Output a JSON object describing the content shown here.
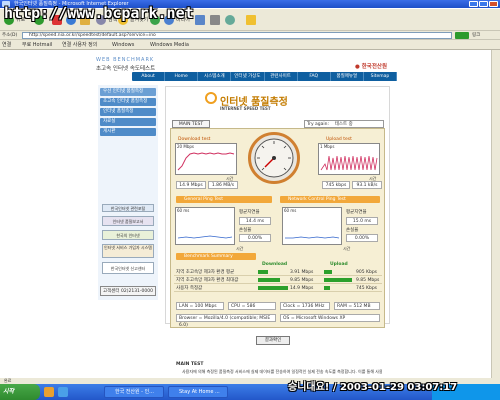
{
  "window": {
    "title": "한국인터넷 품질측정 - Microsoft Internet Explorer"
  },
  "watermark": "http://www.bcpark.net",
  "toolbar": {
    "back": "뒤로",
    "search": "검색",
    "favorites": "즐겨찾기",
    "media": "미디어"
  },
  "address": {
    "label": "주소(D)",
    "url": "http://speed.nia.or.kr/speedtest/default.asp?service=ino",
    "links_label": "링크"
  },
  "links": [
    "연결",
    "무료 Hotmail",
    "연결 사용자 정의",
    "Windows",
    "Windows Media"
  ],
  "site": {
    "logo_top": "WEB BENCHMARK",
    "logo_bottom": "초고속 인터넷 속도테스트",
    "corp": "● 한국전산원",
    "nav": [
      "About",
      "Home",
      "시스템소개",
      "인터넷 가상도",
      "관련사이트",
      "FAQ",
      "품질매뉴얼",
      "Sitemap"
    ],
    "sidebar": [
      "우선 인터넷 품질측정",
      "초고속 인터넷 품질측정",
      "인터넷 품질측정",
      "자료실",
      "게시판"
    ],
    "sidebar_bottom": [
      "한국인터넷 관련포털",
      "인터넷 품질보고서",
      "한국의 인터넷",
      "인터넷 서비스 가입자 시스템",
      "한국인터넷 신고센터"
    ],
    "phone": "고객센터 02)2131-0000"
  },
  "test": {
    "title": "인터넷 품질측정",
    "subtitle": "INTERNET SPEED TEST",
    "tab": "MAIN TEST",
    "try_again": "Try again",
    "host": "테스트 중",
    "download_title": "Download test",
    "upload_title": "Upload test",
    "dl_scale": "20 Mbps",
    "ul_scale": "1 Mbps",
    "time_label": "시간",
    "dl_speed_mbps": "14.9 Mbps",
    "dl_speed_mbps2": "1.86 MB/s",
    "ul_speed_kbps": "745 kbps",
    "ul_speed_kbs": "93.1 kB/s",
    "general_ping": "General Ping Test",
    "network_ping": "Network Control Ping Test",
    "ping1_scale": "60 ms",
    "ping2_scale": "60 ms",
    "avg_rtt_label": "평균지연율",
    "avg_rtt1": "14.4 ms",
    "loss_label": "손실율",
    "loss1": "0.00%",
    "avg_rtt2": "15.0 ms",
    "loss2": "0.00%",
    "summary_header": "Benchmark Summary",
    "download_label": "Download",
    "upload_label": "Upload",
    "rows": [
      {
        "label": "지역 초고속망 제3자 환경 평균",
        "down": "3.91 Mbps",
        "up": "905 Kbps"
      },
      {
        "label": "지역 초고속망 제3자 환경 최대값",
        "down": "9.85 Mbps",
        "up": "9.85 Mbps"
      },
      {
        "label": "사용자 측정값",
        "down": "14.9 Mbps",
        "up": "745 Kbps"
      }
    ],
    "specs": {
      "lan": "LAN = 100 Mbps",
      "cpu": "CPU = 586",
      "clock": "Clock = 1736 MHz",
      "ram": "RAM = 512 MB",
      "browser": "Browser = Mozilla/4.0 (compatible; MSIE 6.0)",
      "os": "OS = Microsoft Windows XP"
    },
    "result_button": "결과확인",
    "note_title": "MAIN TEST",
    "note_text": "사용자에 의해 측정된 품질측정 서비스에 실제 데이터를 전송하여 일정적인 실제 전송 속도를 측정합니다. 이를 통해 사용자 환경에 대한 ..."
  },
  "status": {
    "text": "완료"
  },
  "taskbar": {
    "start": "시작",
    "tasks": [
      "한국 전산원 - 인...",
      "Stay At Home ..."
    ]
  },
  "stamp": "승니대요! / 2003-01-29 03:07:17"
}
